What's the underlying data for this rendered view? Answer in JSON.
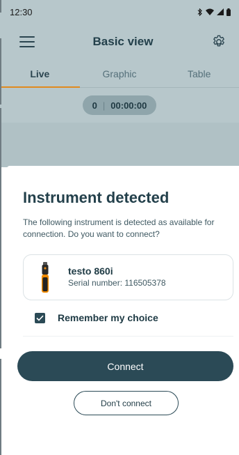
{
  "status_bar": {
    "time": "12:30",
    "icons": [
      "bluetooth-icon",
      "wifi-icon",
      "signal-icon",
      "battery-icon"
    ]
  },
  "header": {
    "title": "Basic view",
    "menu_icon": "menu-icon",
    "settings_icon": "gear-icon"
  },
  "tabs": [
    {
      "label": "Live",
      "active": true
    },
    {
      "label": "Graphic",
      "active": false
    },
    {
      "label": "Table",
      "active": false
    }
  ],
  "timer": {
    "count": "0",
    "separator": "|",
    "elapsed": "00:00:00"
  },
  "dialog": {
    "title": "Instrument detected",
    "description": "The following instrument is detected as available for connection. Do you want to connect?",
    "instrument": {
      "name": "testo 860i",
      "serial": "Serial number: 116505378"
    },
    "remember": {
      "label": "Remember my choice",
      "checked": true
    },
    "connect_label": "Connect",
    "dont_connect_label": "Don't connect"
  },
  "colors": {
    "primary": "#2b4a56",
    "accent": "#e08a1e",
    "scrim": "#b7c7cb"
  }
}
